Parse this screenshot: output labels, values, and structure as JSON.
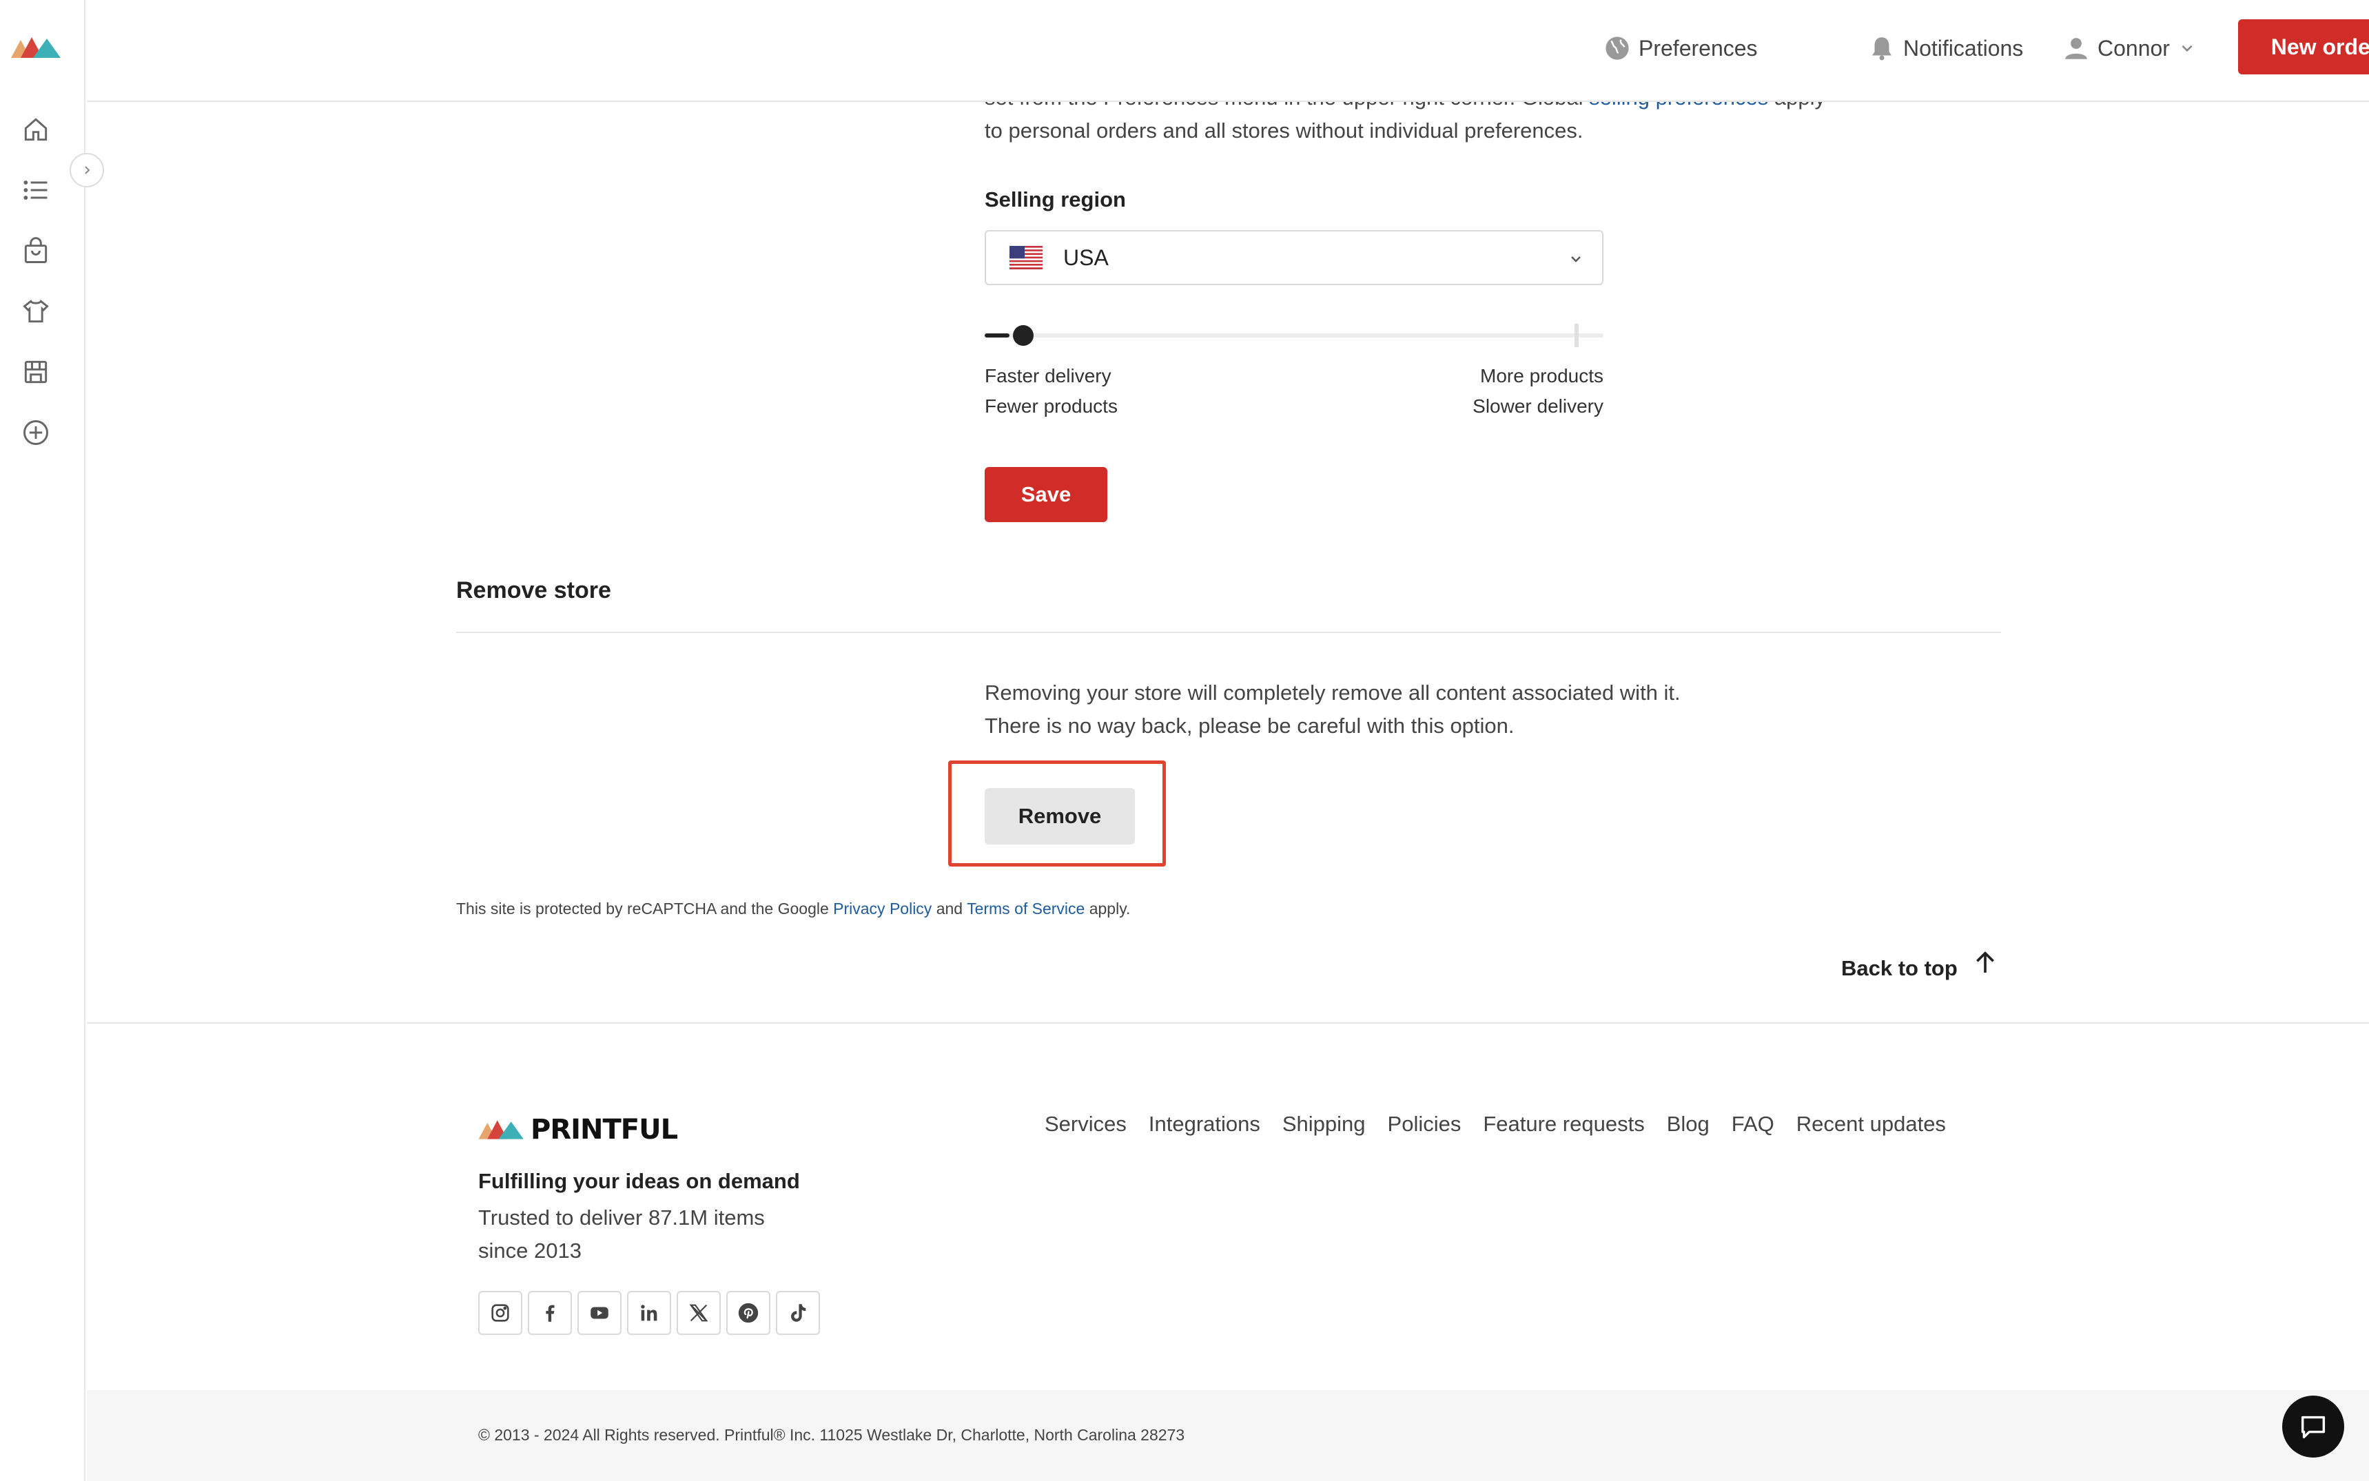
{
  "header": {
    "preferences_label": "Preferences",
    "notifications_label": "Notifications",
    "user_name": "Connor",
    "new_order_label": "New order"
  },
  "sidebar": {
    "items": [
      {
        "name": "home-icon"
      },
      {
        "name": "list-icon"
      },
      {
        "name": "bag-icon"
      },
      {
        "name": "tshirt-icon"
      },
      {
        "name": "store-icon"
      },
      {
        "name": "plus-circle-icon"
      }
    ]
  },
  "preferences_section": {
    "intro_line1_before": "set from the Preferences menu in the upper right corner. Global ",
    "intro_link": "selling preferences",
    "intro_line1_after": " apply",
    "intro_line2": "to personal orders and all stores without individual preferences.",
    "selling_region_label": "Selling region",
    "region_value": "USA",
    "slider_value_fraction": 0.04,
    "left_label_1": "Faster delivery",
    "left_label_2": "Fewer products",
    "right_label_1": "More products",
    "right_label_2": "Slower delivery",
    "save_label": "Save"
  },
  "remove_section": {
    "title": "Remove store",
    "line1": "Removing your store will completely remove all content associated with it.",
    "line2": "There is no way back, please be careful with this option.",
    "remove_label": "Remove"
  },
  "recaptcha": {
    "before": "This site is protected by reCAPTCHA and the Google ",
    "privacy": "Privacy Policy",
    "middle": " and ",
    "terms": "Terms of Service",
    "after": " apply."
  },
  "back_to_top": "Back to top",
  "footer": {
    "brand": "PRINTFUL",
    "tagline": "Fulfilling your ideas on demand",
    "trust_line1": "Trusted to deliver 87.1M items",
    "trust_line2": "since 2013",
    "links": [
      "Services",
      "Integrations",
      "Shipping",
      "Policies",
      "Feature requests",
      "Blog",
      "FAQ",
      "Recent updates"
    ],
    "social": [
      "instagram-icon",
      "facebook-icon",
      "youtube-icon",
      "linkedin-icon",
      "x-icon",
      "pinterest-icon",
      "tiktok-icon"
    ],
    "copyright": "© 2013 - 2024 All Rights reserved. Printful® Inc. 11025 Westlake Dr, Charlotte, North Carolina 28273"
  },
  "colors": {
    "brand_red": "#d22c28",
    "link_blue": "#1f5c9e",
    "highlight": "#e0432f"
  }
}
